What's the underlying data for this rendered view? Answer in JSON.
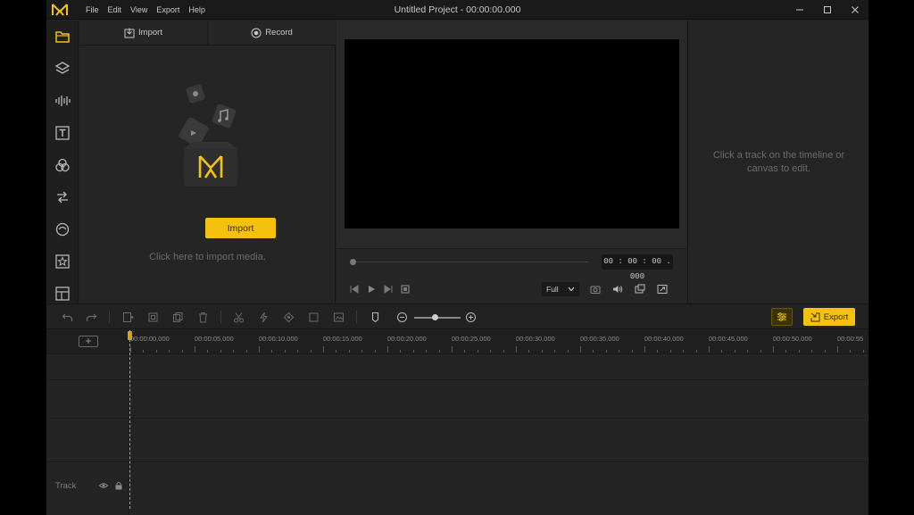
{
  "app": {
    "title": "Untitled Project - 00:00:00.000",
    "accent": "#f4c20d"
  },
  "menu": [
    "File",
    "Edit",
    "View",
    "Export",
    "Help"
  ],
  "window_controls": [
    "minimize-icon",
    "maximize-icon",
    "close-icon"
  ],
  "rail": [
    "folder-icon",
    "layers-icon",
    "audio-wave-icon",
    "text-icon",
    "filters-icon",
    "transitions-icon",
    "sticker-icon",
    "elements-icon",
    "layout-icon"
  ],
  "media": {
    "tabs": [
      {
        "label": "Import",
        "icon": "import-icon"
      },
      {
        "label": "Record",
        "icon": "record-icon"
      }
    ],
    "import_button": "Import",
    "hint": "Click here to import media."
  },
  "preview": {
    "timecode": "00 : 00 : 00 . 000",
    "quality": "Full",
    "progress": 0
  },
  "properties": {
    "hint": "Click a track on the timeline or canvas to edit."
  },
  "toolbar": {
    "export_label": "Export",
    "zoom_level": 0.45
  },
  "timeline": {
    "ruler_labels": [
      "00:00:00.000",
      "00:00:05.000",
      "00:00:10.000",
      "00:00:15.000",
      "00:00:20.000",
      "00:00:25.000",
      "00:00:30.000",
      "00:00:35.000",
      "00:00:40.000",
      "00:00:45.000",
      "00:00:50.000",
      "00:00:55"
    ],
    "track_label": "Track"
  }
}
